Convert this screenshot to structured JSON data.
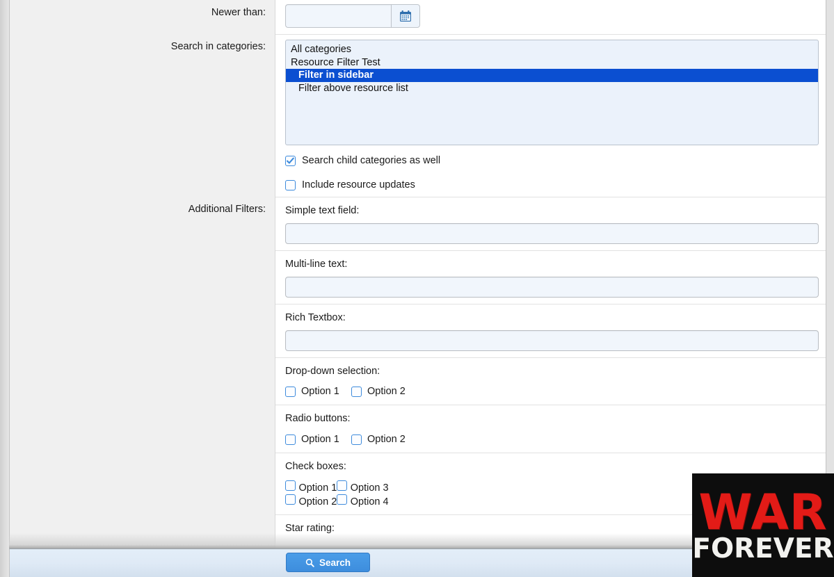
{
  "rows": {
    "newer_than": {
      "label": "Newer than:",
      "date_value": "",
      "calendar_icon": "calendar-icon"
    },
    "search_in_categories": {
      "label": "Search in categories:",
      "options": [
        {
          "text": "All categories",
          "indent": false,
          "selected": false
        },
        {
          "text": "Resource Filter Test",
          "indent": false,
          "selected": false
        },
        {
          "text": "Filter in sidebar",
          "indent": true,
          "selected": true
        },
        {
          "text": "Filter above resource list",
          "indent": true,
          "selected": false
        }
      ],
      "child_categories": {
        "label": "Search child categories as well",
        "checked": true
      },
      "resource_updates": {
        "label": "Include resource updates",
        "checked": false
      }
    },
    "additional_filters": {
      "label": "Additional Filters:",
      "fields": {
        "simple_text": {
          "label": "Simple text field:",
          "value": "",
          "placeholder": ""
        },
        "multi_line": {
          "label": "Multi-line text:",
          "value": "",
          "placeholder": ""
        },
        "rich_textbox": {
          "label": "Rich Textbox:",
          "value": "",
          "placeholder": ""
        },
        "dropdown": {
          "label": "Drop-down selection:",
          "options": [
            {
              "text": "Option 1",
              "checked": false
            },
            {
              "text": "Option 2",
              "checked": false
            }
          ]
        },
        "radio_buttons": {
          "label": "Radio buttons:",
          "options": [
            {
              "text": "Option 1",
              "checked": false
            },
            {
              "text": "Option 2",
              "checked": false
            }
          ]
        },
        "check_boxes": {
          "label": "Check boxes:",
          "col1": [
            {
              "text": "Option 1",
              "checked": false
            },
            {
              "text": "Option 2",
              "checked": false
            }
          ],
          "col2": [
            {
              "text": "Option 3",
              "checked": false
            },
            {
              "text": "Option 4",
              "checked": false
            }
          ]
        },
        "star_rating": {
          "label": "Star rating:"
        }
      }
    }
  },
  "footer": {
    "search_label": "Search",
    "search_icon": "magnifier-icon"
  },
  "watermark": {
    "line1": "WAR",
    "line2": "FOREVER"
  },
  "colors": {
    "selection_blue": "#0b4fd1",
    "button_blue": "#3d8ddd",
    "checkbox_blue": "#3d8bdc",
    "field_background": "#f1f6fc",
    "listbox_background": "#ebf2fb",
    "gutter_gray": "#f0f0f0",
    "watermark_red": "#e31b17"
  }
}
